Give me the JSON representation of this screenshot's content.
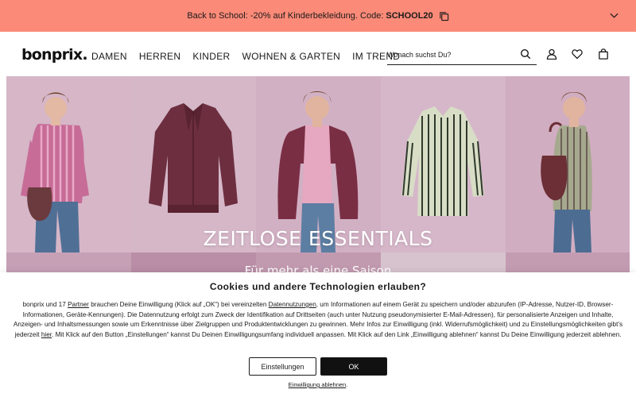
{
  "promo": {
    "text": "Back to School: -20% auf Kinderbekleidung. Code:",
    "code": "SCHOOL20",
    "bg_color": "#fb8a78"
  },
  "header": {
    "logo": "bonprix.",
    "nav": [
      "DAMEN",
      "HERREN",
      "KINDER",
      "WOHNEN & GARTEN",
      "IM TREND"
    ],
    "search_placeholder": "Wonach suchst Du?",
    "icons": [
      "search-icon",
      "account-icon",
      "wishlist-heart-icon",
      "shopping-bag-icon"
    ]
  },
  "hero": {
    "title": "ZEITLOSE ESSENTIALS",
    "subtitle": "Für mehr als eine Saison",
    "bg_color": "#c8a3b8"
  },
  "cookie": {
    "title": "Cookies und andere Technologien erlauben?",
    "t1": "bonprix und 17 ",
    "link_partner": "Partner",
    "t2": " brauchen Deine Einwilligung (Klick auf „OK“) bei vereinzelten ",
    "link_data": "Datennutzungen",
    "t3": ", um Informationen auf einem Gerät zu speichern und/oder abzurufen (IP-Adresse, Nutzer-ID, Browser-Informationen, Geräte-Kennungen). Die Datennutzung erfolgt zum Zweck der Identifikation auf Drittseiten (auch unter Nutzung pseudonymisierter E-Mail-Adressen), für personalisierte Anzeigen und Inhalte, Anzeigen- und Inhaltsmessungen sowie um Erkenntnisse über Zielgruppen und Produktentwicklungen zu gewinnen. Mehr Infos zur Einwilligung (inkl. Widerrufsmöglichkeit) und zu Einstellungsmöglichkeiten gibt’s jederzeit ",
    "link_here": "hier",
    "t4": ". Mit Klick auf den Button „Einstellungen“ kannst Du Deinen Einwilligungsumfang individuell anpassen. Mit Klick auf den Link „Einwilligung ablehnen“ kannst Du Deine Einwilligung jederzeit ablehnen.",
    "settings_label": "Einstellungen",
    "ok_label": "OK",
    "decline_label": "Einwilligung ablehnen",
    "decline_suffix": "."
  }
}
